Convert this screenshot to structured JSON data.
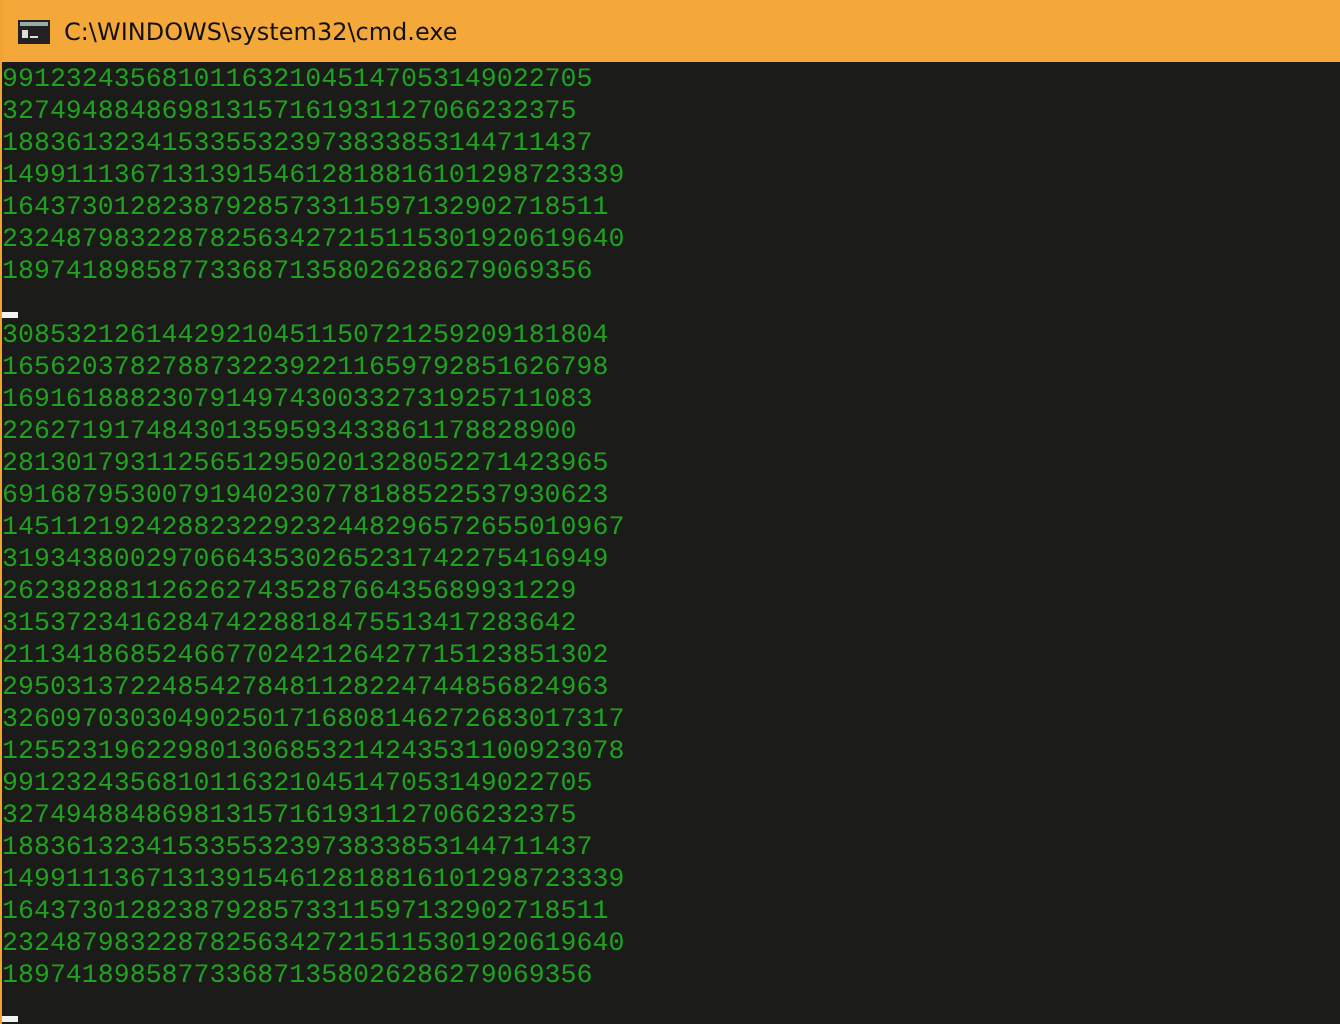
{
  "window": {
    "title": "C:\\WINDOWS\\system32\\cmd.exe"
  },
  "console": {
    "lines": [
      {
        "kind": "text",
        "text": "9912324356810116321045147053149022705"
      },
      {
        "kind": "text",
        "text": "327494884869813157161931127066232375"
      },
      {
        "kind": "text",
        "text": "1883613234153355323973833853144711437"
      },
      {
        "kind": "text",
        "text": "149911136713139154612818816101298723339"
      },
      {
        "kind": "text",
        "text": "16437301282387928573311597132902718511"
      },
      {
        "kind": "text",
        "text": "232487983228782563427215115301920619640"
      },
      {
        "kind": "text",
        "text": "1897418985877336871358026286279069356"
      },
      {
        "kind": "cursor"
      },
      {
        "kind": "text",
        "text": "30853212614429210451150721259209181804"
      },
      {
        "kind": "text",
        "text": "16562037827887322392211659792851626798"
      },
      {
        "kind": "text",
        "text": "1691618882307914974300332731925711083"
      },
      {
        "kind": "text",
        "text": "226271917484301359593433861178828900"
      },
      {
        "kind": "text",
        "text": "28130179311256512950201328052271423965"
      },
      {
        "kind": "text",
        "text": "69168795300791940230778188522537930623"
      },
      {
        "kind": "text",
        "text": "145112192428823229232448296572655010967"
      },
      {
        "kind": "text",
        "text": "31934380029706643530265231742275416949"
      },
      {
        "kind": "text",
        "text": "262382881126262743528766435689931229"
      },
      {
        "kind": "text",
        "text": "315372341628474228818475513417283642"
      },
      {
        "kind": "text",
        "text": "21134186852466770242126427715123851302"
      },
      {
        "kind": "text",
        "text": "29503137224854278481128224744856824963"
      },
      {
        "kind": "text",
        "text": "326097030304902501716808146272683017317"
      },
      {
        "kind": "text",
        "text": "125523196229801306853214243531100923078"
      },
      {
        "kind": "text",
        "text": "9912324356810116321045147053149022705"
      },
      {
        "kind": "text",
        "text": "327494884869813157161931127066232375"
      },
      {
        "kind": "text",
        "text": "1883613234153355323973833853144711437"
      },
      {
        "kind": "text",
        "text": "149911136713139154612818816101298723339"
      },
      {
        "kind": "text",
        "text": "16437301282387928573311597132902718511"
      },
      {
        "kind": "text",
        "text": "232487983228782563427215115301920619640"
      },
      {
        "kind": "text",
        "text": "1897418985877336871358026286279069356"
      },
      {
        "kind": "cursor"
      }
    ]
  }
}
